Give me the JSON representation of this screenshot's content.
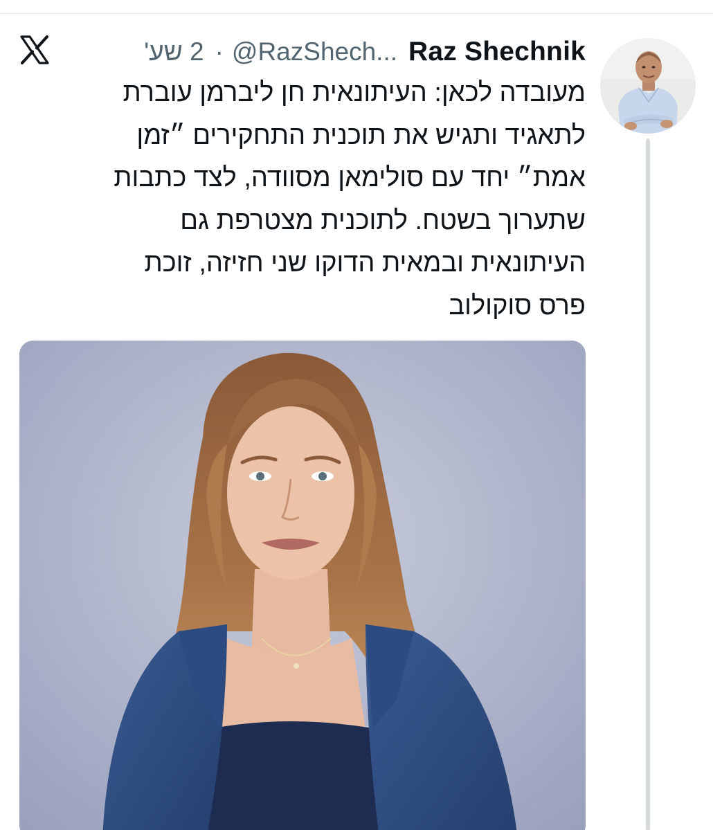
{
  "tweet": {
    "author": {
      "display_name": "Raz Shechnik",
      "handle": "@RazShech...",
      "avatar_icon": "user-avatar-photo"
    },
    "separator": "·",
    "timestamp": "2 שע'",
    "text_lines": [
      "מעובדה לכאן: העיתונאית חן ליברמן עוברת",
      "לתאגיד ותגיש את תוכנית התחקירים ״זמן",
      "אמת״ יחד עם סולימאן מסוודה, לצד כתבות",
      "שתערוך בשטח. לתוכנית מצטרפת גם",
      "העיתונאית ובמאית הדוקו שני חזיזה, זוכת",
      "פרס סוקולוב"
    ],
    "media": {
      "icon": "portrait-photo"
    }
  },
  "app": {
    "logo_icon": "x-logo-icon"
  },
  "colors": {
    "text_primary": "#0f1419",
    "text_secondary": "#536471",
    "thread_line": "#d4d9de",
    "photo_background": "#a9afc6",
    "blazer": "#2d4a7e"
  }
}
